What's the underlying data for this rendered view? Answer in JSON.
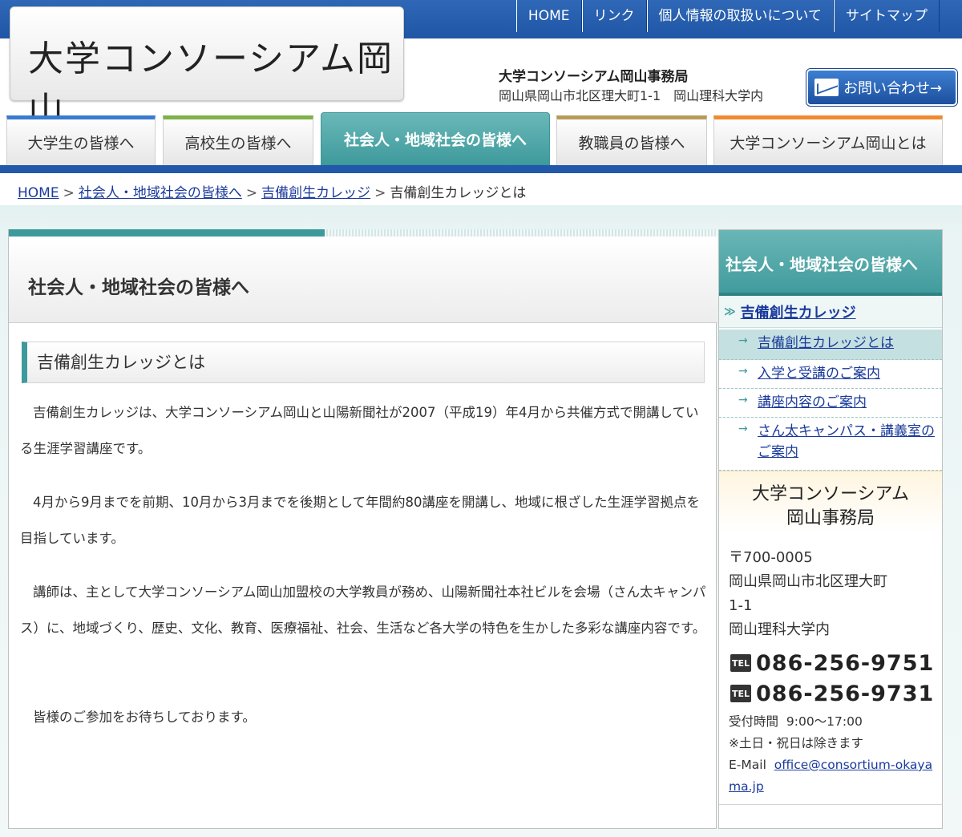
{
  "header": {
    "logo_text": "大学コンソーシアム岡山",
    "top_nav": [
      "HOME",
      "リンク",
      "個人情報の取扱いについて",
      "サイトマップ"
    ],
    "office_name": "大学コンソーシアム岡山事務局",
    "office_address": "岡山県岡山市北区理大町1-1　岡山理科大学内",
    "contact_label": "お問い合わせ→"
  },
  "tabs": [
    {
      "label": "大学生の皆様へ",
      "accent": "#3a7bd0"
    },
    {
      "label": "高校生の皆様へ",
      "accent": "#7fb24a"
    },
    {
      "label": "社会人・地域社会の皆様へ",
      "accent": "#3f9a9c"
    },
    {
      "label": "教職員の皆様へ",
      "accent": "#b89a58"
    },
    {
      "label": "大学コンソーシアム岡山とは",
      "accent": "#f08a2e"
    }
  ],
  "breadcrumb": {
    "items": [
      "HOME",
      "社会人・地域社会の皆様へ",
      "吉備創生カレッジ"
    ],
    "current": "吉備創生カレッジとは",
    "separator": ">"
  },
  "content": {
    "page_title": "社会人・地域社会の皆様へ",
    "section_title": "吉備創生カレッジとは",
    "paragraphs": [
      "吉備創生カレッジは、大学コンソーシアム岡山と山陽新聞社が2007（平成19）年4月から共催方式で開講している生涯学習講座です。",
      "4月から9月までを前期、10月から3月までを後期として年間約80講座を開講し、地域に根ざした生涯学習拠点を目指しています。",
      "講師は、主として大学コンソーシアム岡山加盟校の大学教員が務め、山陽新聞社本社ビルを会場（さん太キャンパス）に、地域づくり、歴史、文化、教育、医療福祉、社会、生活など各大学の特色を生かした多彩な講座内容です。",
      "皆様のご参加をお待ちしております。"
    ]
  },
  "sidebar": {
    "heading": "社会人・地域社会の皆様へ",
    "main_link": "吉備創生カレッジ",
    "main_marker": "≫",
    "sub_marker": "→",
    "sub_links": [
      "吉備創生カレッジとは",
      "入学と受講のご案内",
      "講座内容のご案内",
      "さん太キャンパス・講義室のご案内"
    ],
    "office": {
      "name_line1": "大学コンソーシアム",
      "name_line2": "岡山事務局",
      "postal": "〒700-0005",
      "address1": "岡山県岡山市北区理大町",
      "address2": "1-1",
      "address3": "岡山理科大学内",
      "tel_badge": "TEL",
      "tel1": "086-256-9751",
      "tel2": "086-256-9731",
      "hours_label": "受付時間",
      "hours": "9:00～17:00",
      "note": "※土日・祝日は除きます",
      "email_label": "E-Mail",
      "email": "office@consortium-okayama.jp"
    }
  },
  "colors": {
    "brand_blue": "#2158aa",
    "teal": "#3f9a9c",
    "link": "#1a3a9c"
  }
}
